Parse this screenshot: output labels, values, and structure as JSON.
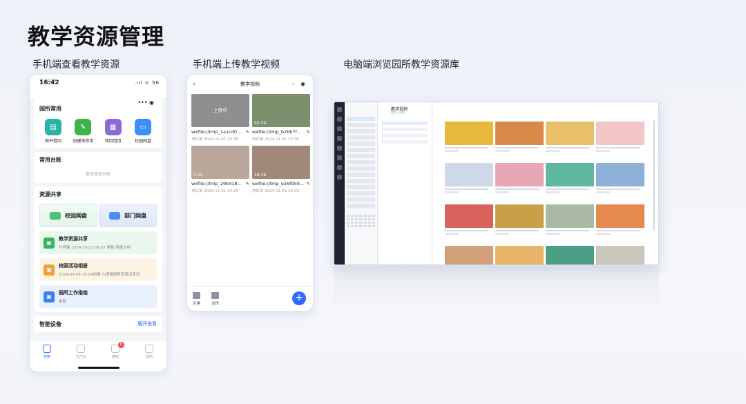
{
  "page": {
    "title": "教学资源管理",
    "sections": [
      "手机端查看教学资源",
      "手机端上传教学视频",
      "电脑端浏览园所教学资源库"
    ]
  },
  "phone1": {
    "time": "16:42",
    "time_ghost": "暂无常用",
    "signal": ".ııl ᯤ 56",
    "menu_glyphs": "••• ◉",
    "common_title": "园所常用",
    "apps": [
      {
        "label": "图书借阅",
        "icon": "book-icon",
        "color": "#2ab3a6"
      },
      {
        "label": "创建维修单",
        "icon": "wrench-icon",
        "color": "#3fb24b"
      },
      {
        "label": "领用借用",
        "icon": "box-icon",
        "color": "#8a6bd8"
      },
      {
        "label": "校园网盘",
        "icon": "disk-icon",
        "color": "#3d8ef5"
      }
    ],
    "ledger_title": "常用台账",
    "ledger_empty": "暂无常用台账",
    "share_title": "资源共享",
    "disk_school": "校园网盘",
    "disk_dept": "部门网盘",
    "feeds": [
      {
        "title": "教学资源共享",
        "sub": "叶梓锋  2024-10-23 09:07 更新 网盘文档",
        "bg": "#eaf7ee",
        "icon_color": "#35b55e"
      },
      {
        "title": "校园活动相册",
        "sub": "2024-09-04 16:04创建 心理健康教育培训活动",
        "bg": "#fdf3e3",
        "icon_color": "#f0a23a"
      },
      {
        "title": "园所工作指南",
        "sub": "更新",
        "bg": "#e8f0fc",
        "icon_color": "#3c7ff0"
      }
    ],
    "device_title": "智能设备",
    "device_expand": "展开查看",
    "tabs": [
      "常用",
      "工作台",
      "通知",
      "我的"
    ],
    "badge": "8"
  },
  "phone2": {
    "title": "教学视频",
    "uploading": "上传中",
    "videos": [
      {
        "name": "wxfile://tmp_1a1cd0...",
        "meta": "刘红英  2024-11-01 20:38",
        "duration": "",
        "bg": "#8f8f8f"
      },
      {
        "name": "wxfile://tmp_b2bb7f...",
        "meta": "刘红英  2024-11-01 20:36",
        "duration": "02:34",
        "bg": "#7c8f6c"
      },
      {
        "name": "wxfile://tmp_29b418...",
        "meta": "刘红英  2024-11-01 20:25",
        "duration": "0:15",
        "bg": "#b8a79a"
      },
      {
        "name": "wxfile://tmp_e26f959...",
        "meta": "刘红英  2024-11-01 20:25",
        "duration": "16:36",
        "bg": "#a08978"
      }
    ],
    "actions": [
      "创建",
      "选择"
    ],
    "fab": "+"
  },
  "desktop": {
    "title": "教学视频",
    "subtitle": "首页 / 视频",
    "thumb_colors": [
      "#e6b93a",
      "#d98a4a",
      "#e9c06a",
      "#f3c6c8",
      "#cfd8e8",
      "#e6a8b4",
      "#5fb8a2",
      "#8fb1d9",
      "#d8635d",
      "#c9a04a",
      "#a9b9a4",
      "#e48a4e",
      "#d2a07a",
      "#e8b46a",
      "#4d9e86",
      "#c9c6bc"
    ]
  }
}
